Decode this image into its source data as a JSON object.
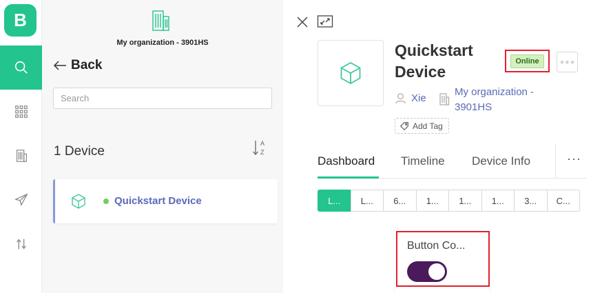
{
  "app": {
    "logo_letter": "B"
  },
  "rail": {
    "items": [
      {
        "icon": "search-icon",
        "active": true
      },
      {
        "icon": "grid-icon",
        "active": false
      },
      {
        "icon": "building-icon",
        "active": false
      },
      {
        "icon": "send-icon",
        "active": false
      },
      {
        "icon": "swap-icon",
        "active": false
      }
    ]
  },
  "list": {
    "org_name": "My organization - 3901HS",
    "back_label": "Back",
    "search_placeholder": "Search",
    "count_label": "1 Device",
    "sort_letters": [
      "A",
      "Z"
    ],
    "devices": [
      {
        "name": "Quickstart Device",
        "status": "online"
      }
    ]
  },
  "detail": {
    "title": "Quickstart Device",
    "status_badge": "Online",
    "more_label": "∘∘∘",
    "owner": "Xie",
    "organization": "My organization - 3901HS",
    "add_tag_label": "Add Tag",
    "tabs": [
      {
        "label": "Dashboard",
        "active": true
      },
      {
        "label": "Timeline",
        "active": false
      },
      {
        "label": "Device Info",
        "active": false
      }
    ],
    "tabs_more": "···",
    "time_ranges": [
      "L...",
      "L...",
      "6...",
      "1...",
      "1...",
      "1...",
      "3...",
      "C..."
    ],
    "widget": {
      "title": "Button Co...",
      "switch_on": true
    }
  },
  "colors": {
    "brand": "#23c48e",
    "link": "#5a69b8",
    "highlight": "#e0202c",
    "switch": "#4a1a5c"
  }
}
